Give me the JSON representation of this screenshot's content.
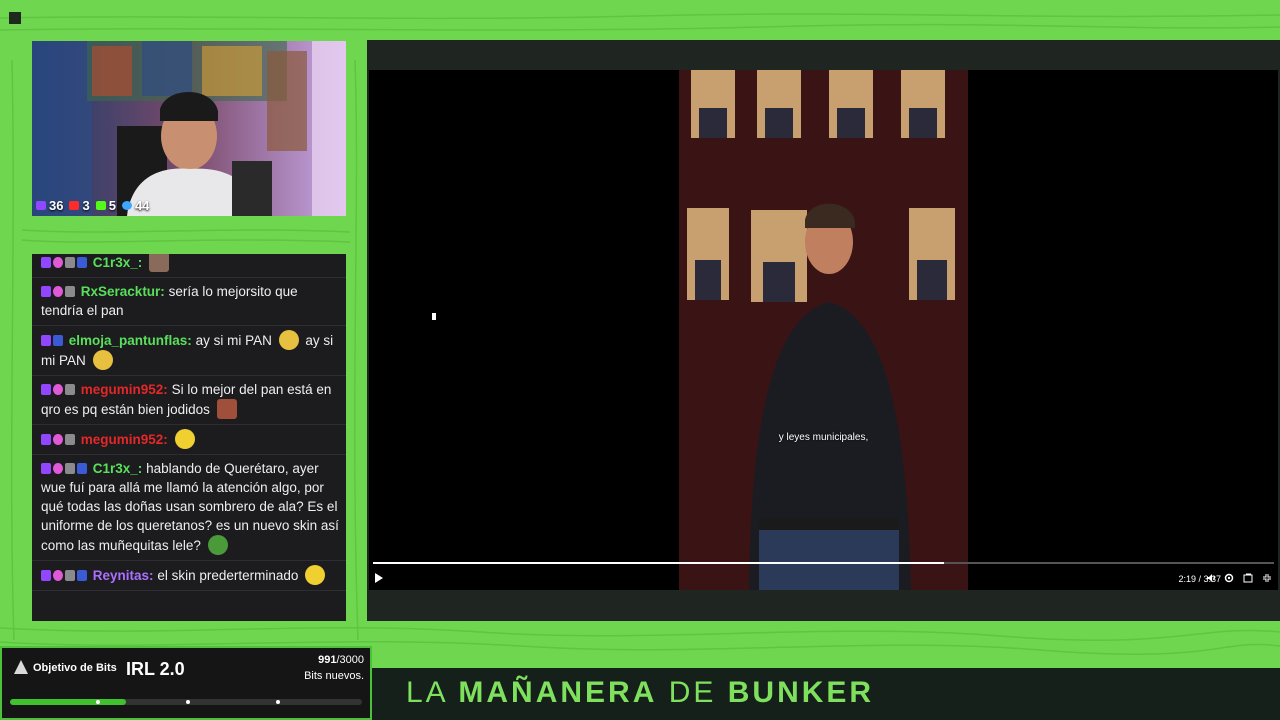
{
  "webcam": {
    "stats": [
      {
        "icon": "twitch-chat-icon",
        "value": "36",
        "color": "#9146ff"
      },
      {
        "icon": "youtube-icon",
        "value": "3",
        "color": "#ff2a2a"
      },
      {
        "icon": "kick-icon",
        "value": "5",
        "color": "#53fc18"
      },
      {
        "icon": "viewers-icon",
        "value": "44",
        "color": "#3ea6ff"
      }
    ]
  },
  "chat": {
    "messages": [
      {
        "user": "C1r3x_:",
        "text": "",
        "color": "#59e05b"
      },
      {
        "user": "RxSeracktur:",
        "text": "sería lo mejorsito que tendría el pan",
        "color": "#59e05b"
      },
      {
        "user": "elmoja_pantunflas:",
        "text": "ay si mi PAN",
        "text2": "ay si mi PAN",
        "color": "#59e05b"
      },
      {
        "user": "megumin952:",
        "text": "Si lo mejor del pan está en qro es pq están bien jodidos",
        "color": "#e52727"
      },
      {
        "user": "megumin952:",
        "text": "",
        "color": "#e52727"
      },
      {
        "user": "C1r3x_:",
        "text": "hablando de Querétaro, ayer wue fuí para allá me llamó la atención algo, por qué todas las doñas usan sombrero de ala? Es el uniforme de los queretanos? es un nuevo skin así como las muñequitas lele?",
        "color": "#59e05b"
      },
      {
        "user": "Reynitas:",
        "text": "el skin prederterminado",
        "color": "#a970ff"
      }
    ]
  },
  "video": {
    "subtitle": "y leyes municipales,",
    "time": "2:19 / 3:37",
    "progress": 0.634
  },
  "bits": {
    "label": "Objetivo de Bits",
    "title": "IRL 2.0",
    "current": "991",
    "goal": "/3000",
    "sub": "Bits nuevos.",
    "progress": 0.33
  },
  "banner": {
    "la": "LA",
    "mananera": "MAÑANERA",
    "de": "DE",
    "bunker": "BUNKER"
  }
}
